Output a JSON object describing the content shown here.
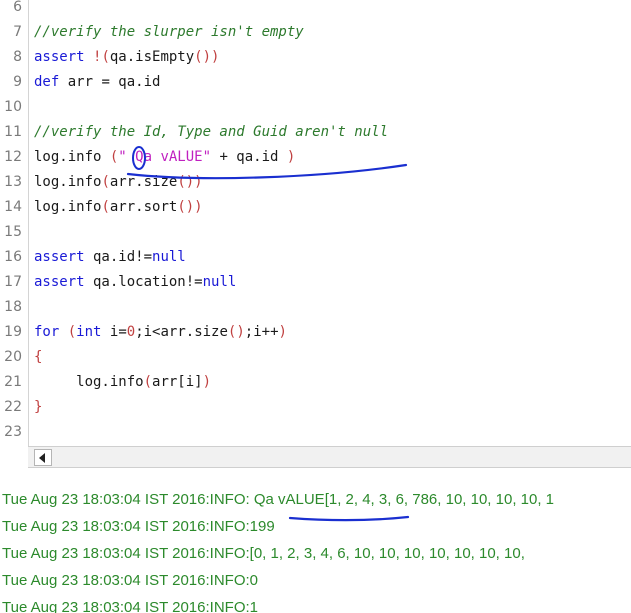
{
  "editor": {
    "lines": [
      {
        "n": "6",
        "tokens": []
      },
      {
        "n": "7",
        "tokens": [
          {
            "t": "//verify the slurper isn't empty",
            "c": "cm"
          }
        ]
      },
      {
        "n": "8",
        "tokens": [
          {
            "t": "assert",
            "c": "kw"
          },
          {
            "t": " ",
            "c": ""
          },
          {
            "t": "!(",
            "c": "pn"
          },
          {
            "t": "qa.isEmpty",
            "c": ""
          },
          {
            "t": "())",
            "c": "pn"
          }
        ]
      },
      {
        "n": "9",
        "tokens": [
          {
            "t": "def",
            "c": "kw"
          },
          {
            "t": " arr = qa.id",
            "c": ""
          }
        ]
      },
      {
        "n": "10",
        "tokens": []
      },
      {
        "n": "11",
        "tokens": [
          {
            "t": "//verify the Id, Type and Guid aren't null",
            "c": "cm"
          }
        ]
      },
      {
        "n": "12",
        "tokens": [
          {
            "t": "log.info ",
            "c": ""
          },
          {
            "t": "(",
            "c": "pn"
          },
          {
            "t": "\" Qa vALUE\"",
            "c": "st"
          },
          {
            "t": " + qa.id ",
            "c": ""
          },
          {
            "t": ")",
            "c": "pn"
          }
        ]
      },
      {
        "n": "13",
        "tokens": [
          {
            "t": "log.info",
            "c": ""
          },
          {
            "t": "(",
            "c": "pn"
          },
          {
            "t": "arr.size",
            "c": ""
          },
          {
            "t": "())",
            "c": "pn"
          }
        ]
      },
      {
        "n": "14",
        "tokens": [
          {
            "t": "log.info",
            "c": ""
          },
          {
            "t": "(",
            "c": "pn"
          },
          {
            "t": "arr.sort",
            "c": ""
          },
          {
            "t": "())",
            "c": "pn"
          }
        ]
      },
      {
        "n": "15",
        "tokens": []
      },
      {
        "n": "16",
        "tokens": [
          {
            "t": "assert",
            "c": "kw"
          },
          {
            "t": " qa.id!=",
            "c": ""
          },
          {
            "t": "null",
            "c": "kw"
          }
        ]
      },
      {
        "n": "17",
        "tokens": [
          {
            "t": "assert",
            "c": "kw"
          },
          {
            "t": " qa.location!=",
            "c": ""
          },
          {
            "t": "null",
            "c": "kw"
          }
        ]
      },
      {
        "n": "18",
        "tokens": []
      },
      {
        "n": "19",
        "tokens": [
          {
            "t": "for",
            "c": "kw"
          },
          {
            "t": " ",
            "c": ""
          },
          {
            "t": "(",
            "c": "pn"
          },
          {
            "t": "int",
            "c": "kw"
          },
          {
            "t": " i=",
            "c": ""
          },
          {
            "t": "0",
            "c": "nu"
          },
          {
            "t": ";i<arr.size",
            "c": ""
          },
          {
            "t": "()",
            "c": "pn"
          },
          {
            "t": ";i++",
            "c": ""
          },
          {
            "t": ")",
            "c": "pn"
          }
        ]
      },
      {
        "n": "20",
        "tokens": [
          {
            "t": "{",
            "c": "pn"
          }
        ]
      },
      {
        "n": "21",
        "tokens": [
          {
            "t": "     log.info",
            "c": ""
          },
          {
            "t": "(",
            "c": "pn"
          },
          {
            "t": "arr[i]",
            "c": ""
          },
          {
            "t": ")",
            "c": "pn"
          }
        ]
      },
      {
        "n": "22",
        "tokens": [
          {
            "t": "}",
            "c": "pn"
          }
        ]
      },
      {
        "n": "23",
        "tokens": []
      }
    ]
  },
  "log": {
    "lines": [
      "Tue Aug 23 18:03:04 IST 2016:INFO: Qa vALUE[1, 2, 4, 3, 6, 786, 10, 10, 10, 10, 1",
      "Tue Aug 23 18:03:04 IST 2016:INFO:199",
      "Tue Aug 23 18:03:04 IST 2016:INFO:[0, 1, 2, 3, 4, 6, 10, 10, 10, 10, 10, 10, 10,",
      "Tue Aug 23 18:03:04 IST 2016:INFO:0",
      "Tue Aug 23 18:03:04 IST 2016:INFO:1"
    ]
  },
  "colors": {
    "keyword": "#1a1ad6",
    "comment": "#2d7a2d",
    "paren": "#c04040",
    "string": "#c020c0",
    "log_text": "#2c8a2c",
    "annotation": "#1a2fd0"
  },
  "icons": {
    "scroll_left": "scroll-left-arrow-icon"
  }
}
